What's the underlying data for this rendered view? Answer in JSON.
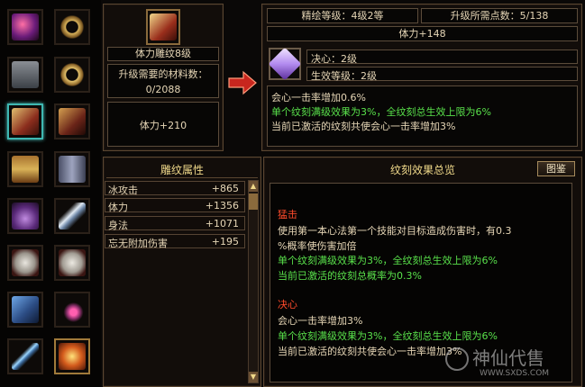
{
  "item_panel": {
    "title": "体力雕纹8级",
    "materials_label": "升级需要的材料数：",
    "materials_value": "0/2088",
    "stat": "体力+210"
  },
  "upgrade_panel": {
    "refine_level": "精绘等级：4级2等",
    "points_needed": "升级所需点数：5/138",
    "stat": "体力+148",
    "gem_name": "决心：2级",
    "effect_level": "生效等级：2级",
    "desc_line1": "会心一击率增加0.6%",
    "desc_line2": "单个纹刻满级效果为3%，全纹刻总生效上限为6%",
    "desc_line3": "当前已激活的纹刻共使会心一击率增加3%"
  },
  "attributes_panel": {
    "title": "雕纹属性",
    "rows": [
      {
        "name": "冰攻击",
        "value": "+865"
      },
      {
        "name": "体力",
        "value": "+1356"
      },
      {
        "name": "身法",
        "value": "+1071"
      },
      {
        "name": "忘无附加伤害",
        "value": "+195"
      }
    ]
  },
  "overview_panel": {
    "title": "纹刻效果总览",
    "button_label": "图鉴",
    "sections": [
      {
        "title": "猛击",
        "line1": "使用第一本心法第一个技能对目标造成伤害时，有0.3",
        "line2": "%概率使伤害加倍",
        "line3": "单个纹刻满级效果为3%，全纹刻总生效上限为6%",
        "line4": "当前已激活的纹刻总概率为0.3%"
      },
      {
        "title": "决心",
        "line1": "会心一击率增加3%",
        "line2": "单个纹刻满级效果为3%，全纹刻总生效上限为6%",
        "line3": "当前已激活的纹刻共使会心一击率增加3%"
      }
    ]
  },
  "watermark": {
    "brand": "神仙代售",
    "url": "WWW.SXDS.COM"
  },
  "colors": {
    "gold": "#f0d98a",
    "green": "#59e14b",
    "red": "#ff4b2b",
    "selected_slot": "#3fb8b2"
  },
  "equipment_icons": [
    "magic-wand-icon",
    "ring-icon",
    "chest-armor-icon",
    "ring-icon",
    "bracer-icon",
    "bracer-icon",
    "belt-icon",
    "boots-icon",
    "crown-icon",
    "dagger-icon",
    "jade-pendant-icon",
    "jade-pendant-icon",
    "gauntlet-icon",
    "amulet-icon",
    "sword-icon",
    "gem-icon"
  ]
}
